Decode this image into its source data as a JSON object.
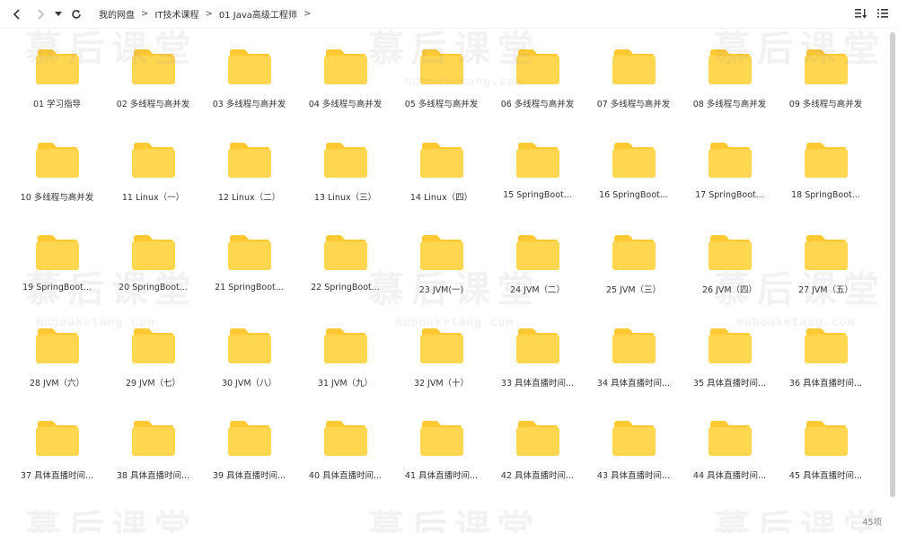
{
  "toolbar": {
    "back_icon": "chevron-left-icon",
    "forward_icon": "chevron-right-icon",
    "history_icon": "caret-down-icon",
    "refresh_icon": "refresh-icon",
    "sort_icon": "sort-icon",
    "view_icon": "list-view-icon"
  },
  "breadcrumb": [
    {
      "label": "我的网盘"
    },
    {
      "label": "IT技术课程"
    },
    {
      "label": "01 Java高级工程师"
    }
  ],
  "folders": [
    {
      "label": "01 学习指导"
    },
    {
      "label": "02 多线程与高并发"
    },
    {
      "label": "03 多线程与高并发"
    },
    {
      "label": "04 多线程与高并发"
    },
    {
      "label": "05 多线程与高并发"
    },
    {
      "label": "06 多线程与高并发"
    },
    {
      "label": "07 多线程与高并发"
    },
    {
      "label": "08 多线程与高并发"
    },
    {
      "label": "09 多线程与高并发"
    },
    {
      "label": "10 多线程与高并发"
    },
    {
      "label": "11 Linux（一）"
    },
    {
      "label": "12 Linux（二）"
    },
    {
      "label": "13 Linux（三）"
    },
    {
      "label": "14 Linux（四）"
    },
    {
      "label": "15 SpringBoot..."
    },
    {
      "label": "16 SpringBoot..."
    },
    {
      "label": "17 SpringBoot..."
    },
    {
      "label": "18 SpringBoot..."
    },
    {
      "label": "19 SpringBoot..."
    },
    {
      "label": "20 SpringBoot..."
    },
    {
      "label": "21 SpringBoot..."
    },
    {
      "label": "22 SpringBoot..."
    },
    {
      "label": "23 JVM(一)"
    },
    {
      "label": "24 JVM（二）"
    },
    {
      "label": "25 JVM（三）"
    },
    {
      "label": "26 JVM（四）"
    },
    {
      "label": "27 JVM（五）"
    },
    {
      "label": "28 JVM（六）"
    },
    {
      "label": "29 JVM（七）"
    },
    {
      "label": "30 JVM（八）"
    },
    {
      "label": "31 JVM（九）"
    },
    {
      "label": "32 JVM（十）"
    },
    {
      "label": "33 具体直播时间..."
    },
    {
      "label": "34 具体直播时间..."
    },
    {
      "label": "35 具体直播时间..."
    },
    {
      "label": "36 具体直播时间..."
    },
    {
      "label": "37 具体直播时间..."
    },
    {
      "label": "38 具体直播时间..."
    },
    {
      "label": "39 具体直播时间..."
    },
    {
      "label": "40 具体直播时间..."
    },
    {
      "label": "41 具体直播时间..."
    },
    {
      "label": "42 具体直播时间..."
    },
    {
      "label": "43 具体直播时间..."
    },
    {
      "label": "44 具体直播时间..."
    },
    {
      "label": "45 具体直播时间..."
    }
  ],
  "footer": {
    "count": "45项"
  },
  "watermark": {
    "text": "慕后课堂",
    "url": "muhouketang.com"
  },
  "colors": {
    "folder_body": "#FFD64F",
    "folder_tab": "#FFC933",
    "accent": "#06a7ff"
  }
}
